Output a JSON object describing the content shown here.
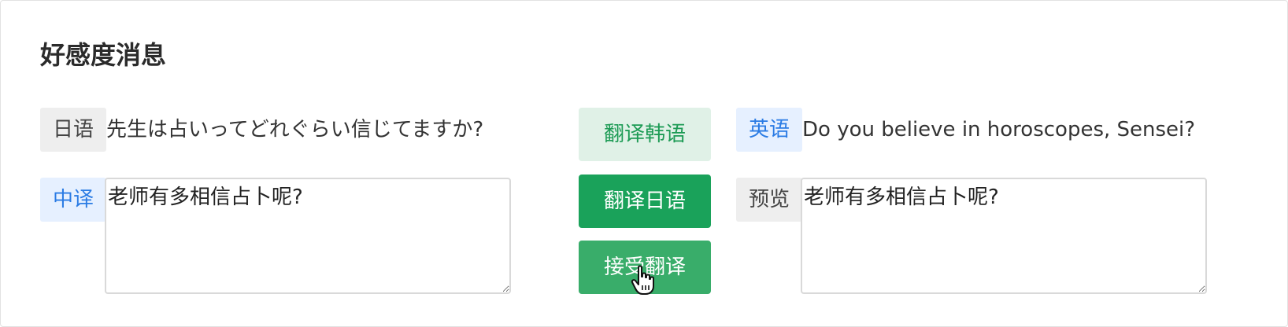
{
  "section": {
    "title": "好感度消息"
  },
  "left": {
    "source_tag": "日语",
    "source_text": "先生は占いってどれぐらい信じてますか?",
    "translation_tag": "中译",
    "translation_value": "老师有多相信占卜呢?"
  },
  "actions": {
    "translate_korean": "翻译韩语",
    "translate_japanese": "翻译日语",
    "accept_translation": "接受翻译"
  },
  "right": {
    "source_tag": "英语",
    "source_text": "Do you believe in horoscopes, Sensei?",
    "preview_tag": "预览",
    "preview_value": "老师有多相信占卜呢?"
  },
  "colors": {
    "accent_green": "#1aa25a",
    "light_green": "#e0f1e7",
    "tag_blue": "#2a7be4"
  }
}
